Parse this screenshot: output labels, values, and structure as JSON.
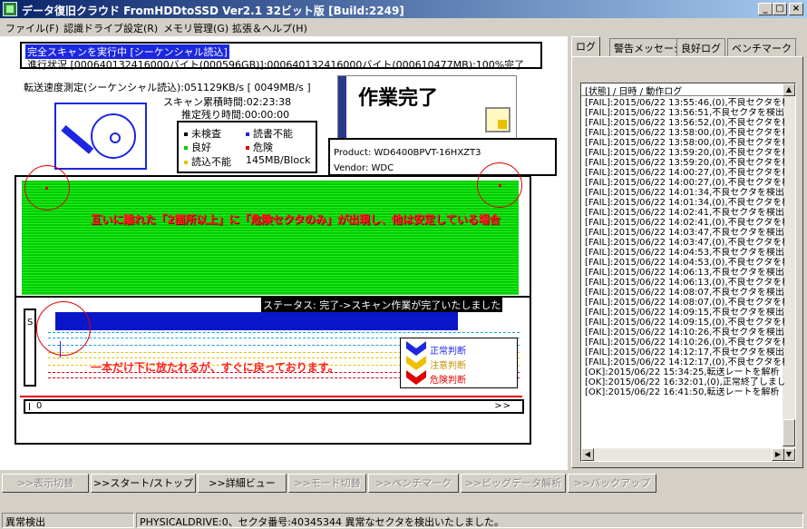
{
  "window": {
    "title": "データ復旧クラウド FromHDDtoSSD Ver2.1 32ビット版 [Build:2249]",
    "btn_min": "_",
    "btn_max": "□",
    "btn_close": "×"
  },
  "menu": [
    "ファイル(F)",
    "認識ドライブ設定(R)",
    "メモリ管理(G)",
    "拡張＆ヘルプ(H)"
  ],
  "scan": {
    "running": "完全スキャンを実行中 [シーケンシャル読込]",
    "progress": "進行状況 [000640132416000バイト(000596GB)]:000640132416000バイト(000610477MB):100%完了",
    "speed": "転送速度測定(シーケンシャル読込):051129KB/s [ 0049MB/s ]",
    "elapsed": "スキャン累積時間:02:23:38",
    "remaining": "推定残り時間:00:00:00"
  },
  "legend": {
    "unchecked": "未検査",
    "unreadable": "読書不能",
    "good": "良好",
    "danger": "危険",
    "read_failed": "読込不能",
    "block": "145MB/Block",
    "colors": {
      "unchecked": "#000000",
      "unreadable": "#1c27e0",
      "good": "#00cc00",
      "danger": "#e00000",
      "read_failed": "#e8c000"
    }
  },
  "status_panel": {
    "done": "作業完了",
    "product": "Product: WD6400BPVT-16HXZT3",
    "vendor": "Vendor: WDC"
  },
  "map": {
    "annotation": "互いに離れた「2箇所以上」に「危険セクタのみ」が出現し、他は安定している場合"
  },
  "status_area": {
    "status": "ステータス: 完了->スキャン作業が完了いたしました",
    "s_label": "S",
    "annotation": "一本だけ下に放たれるが、すぐに戻っております。",
    "legend_normal": "正常判断",
    "legend_caution": "注意判断",
    "legend_danger": "危険判断",
    "timeline_start": "0",
    "timeline_end": ">>"
  },
  "tabs": [
    "ログ",
    "警告メッセージ",
    "良好ログ",
    "ベンチマーク"
  ],
  "log": {
    "header": "[状態] / 日時 / 動作ログ",
    "rows": [
      "[FAIL]:2015/06/22 13:55:46,(0),不良セクタを検出",
      "[FAIL]:2015/06/22 13:56:51,不良セクタを検出",
      "[FAIL]:2015/06/22 13:56:52,(0),不良セクタを検出",
      "[FAIL]:2015/06/22 13:58:00,(0),不良セクタを検出",
      "[FAIL]:2015/06/22 13:58:00,(0),不良セクタを検出",
      "[FAIL]:2015/06/22 13:59:20,(0),不良セクタを検出",
      "[FAIL]:2015/06/22 13:59:20,(0),不良セクタを検出",
      "[FAIL]:2015/06/22 14:00:27,(0),不良セクタを検出",
      "[FAIL]:2015/06/22 14:00:27,(0),不良セクタを検出",
      "[FAIL]:2015/06/22 14:01:34,不良セクタを検出",
      "[FAIL]:2015/06/22 14:01:34,(0),不良セクタを検出",
      "[FAIL]:2015/06/22 14:02:41,不良セクタを検出",
      "[FAIL]:2015/06/22 14:02:41,(0),不良セクタを検出",
      "[FAIL]:2015/06/22 14:03:47,不良セクタを検出",
      "[FAIL]:2015/06/22 14:03:47,(0),不良セクタを検出",
      "[FAIL]:2015/06/22 14:04:53,不良セクタを検出",
      "[FAIL]:2015/06/22 14:04:53,(0),不良セクタを検出",
      "[FAIL]:2015/06/22 14:06:13,不良セクタを検出",
      "[FAIL]:2015/06/22 14:06:13,(0),不良セクタを検出",
      "[FAIL]:2015/06/22 14:08:07,不良セクタを検出",
      "[FAIL]:2015/06/22 14:08:07,(0),不良セクタを検出",
      "[FAIL]:2015/06/22 14:09:15,不良セクタを検出",
      "[FAIL]:2015/06/22 14:09:15,(0),不良セクタを検出",
      "[FAIL]:2015/06/22 14:10:26,不良セクタを検出",
      "[FAIL]:2015/06/22 14:10:26,(0),不良セクタを検出",
      "[FAIL]:2015/06/22 14:12:17,不良セクタを検出",
      "[FAIL]:2015/06/22 14:12:17,(0),不良セクタを検出",
      "[OK]:2015/06/22 15:34:25,転送レートを解析",
      "[OK]:2015/06/22 16:32:01,(0),正常終了しまし",
      "[OK]:2015/06/22 16:41:50,転送レートを解析"
    ]
  },
  "buttons": [
    {
      "label": ">>表示切替",
      "enabled": false
    },
    {
      "label": ">>スタート/ストップ",
      "enabled": true
    },
    {
      "label": ">>詳細ビュー",
      "enabled": true
    },
    {
      "label": ">>モード切替",
      "enabled": false
    },
    {
      "label": ">>ベンチマーク",
      "enabled": false
    },
    {
      "label": ">>ビッグデータ解析",
      "enabled": false
    },
    {
      "label": ">>バックアップ",
      "enabled": false
    }
  ],
  "statusbar": {
    "left": "異常検出",
    "right": "PHYSICALDRIVE:0、セクタ番号:40345344 異常なセクタを検出いたしました。"
  }
}
